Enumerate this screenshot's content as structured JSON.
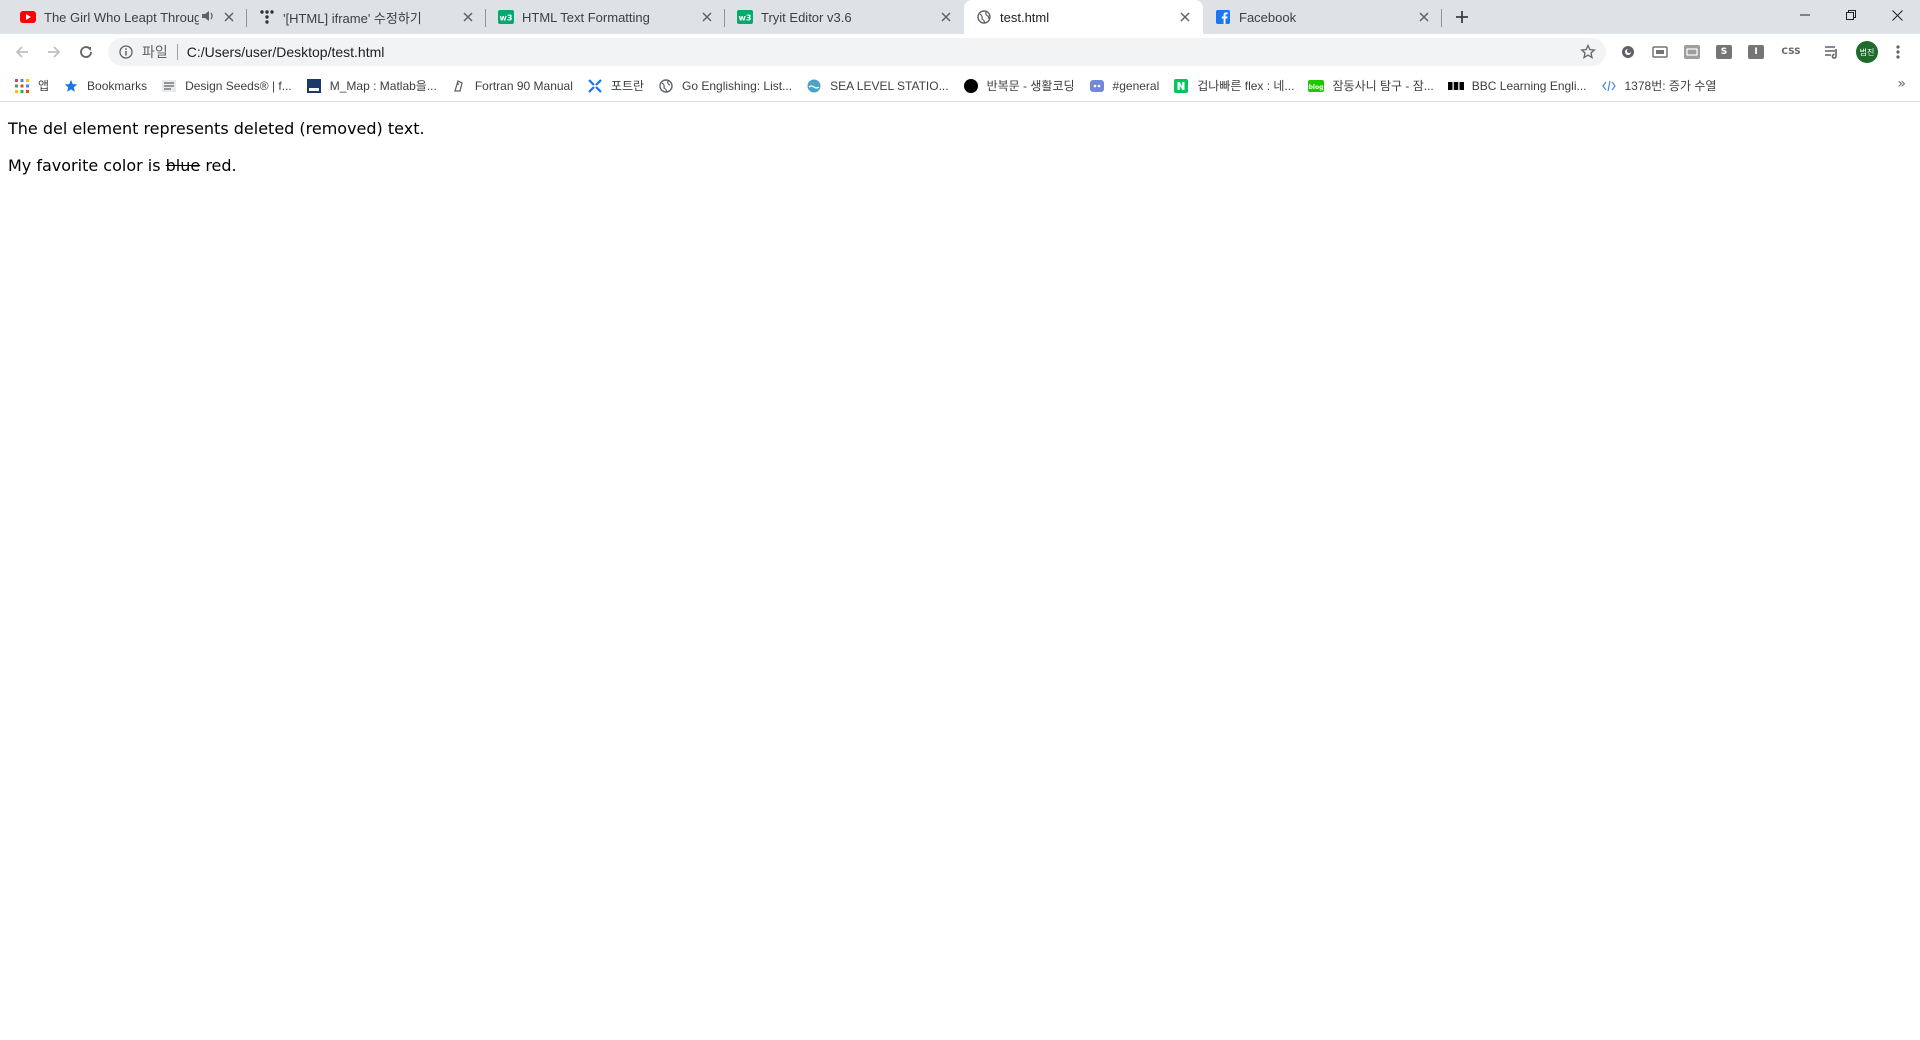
{
  "tabs": [
    {
      "title": "The Girl Who Leapt Through Time",
      "favicon": "youtube-icon",
      "audio": "◀ⅼ",
      "active": false
    },
    {
      "title": "'[HTML] iframe' 수정하기",
      "favicon": "tistory-icon",
      "active": false
    },
    {
      "title": "HTML Text Formatting",
      "favicon": "w3schools-icon",
      "active": false
    },
    {
      "title": "Tryit Editor v3.6",
      "favicon": "w3schools-icon",
      "active": false
    },
    {
      "title": "test.html",
      "favicon": "globe-icon",
      "active": true
    },
    {
      "title": "Facebook",
      "favicon": "facebook-icon",
      "active": false
    }
  ],
  "omnibox": {
    "scheme_label": "파일",
    "url": "C:/Users/user/Desktop/test.html"
  },
  "extensions": [
    "circle-ext-icon",
    "screen-ext-icon",
    "rss-ext-icon",
    "s-ext-icon",
    "i-ext-icon",
    "css-ext-icon"
  ],
  "extension_labels": {
    "s": "S",
    "i": "I",
    "css": "CSS"
  },
  "avatar_label": "범진",
  "bookmarks": [
    {
      "label": "앱",
      "icon": "apps-grid-icon"
    },
    {
      "label": "Bookmarks",
      "icon": "star-icon"
    },
    {
      "label": "Design Seeds® | f...",
      "icon": "design-seeds-icon"
    },
    {
      "label": "M_Map : Matlab을...",
      "icon": "map-icon"
    },
    {
      "label": "Fortran 90 Manual",
      "icon": "fortran-icon"
    },
    {
      "label": "포트란",
      "icon": "compass-icon"
    },
    {
      "label": "Go Englishing: List...",
      "icon": "globe-icon"
    },
    {
      "label": "SEA LEVEL STATIO...",
      "icon": "sea-level-icon"
    },
    {
      "label": "반복문 - 생활코딩",
      "icon": "black-circle-icon"
    },
    {
      "label": "#general",
      "icon": "discord-icon"
    },
    {
      "label": "겁나빠른 flex : 네...",
      "icon": "naver-icon"
    },
    {
      "label": "잠동사니 탐구 - 잠...",
      "icon": "blog-icon"
    },
    {
      "label": "BBC Learning Engli...",
      "icon": "bbc-icon"
    },
    {
      "label": "1378번: 증가 수열",
      "icon": "code-icon"
    }
  ],
  "bookmarks_more": "»",
  "page": {
    "line1": "The del element represents deleted (removed) text.",
    "line2_prefix": "My favorite color is ",
    "line2_deleted": "blue",
    "line2_suffix": " red."
  },
  "colors": {
    "tabstrip": "#dee1e6",
    "youtube": "#ff0000",
    "w3schools": "#04aa6d",
    "facebook": "#1877f2",
    "naver": "#03c75a",
    "avatar": "#1e6b2d"
  }
}
